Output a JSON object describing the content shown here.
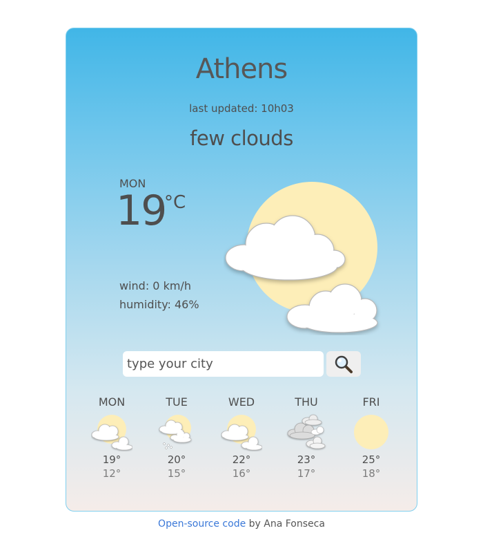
{
  "current": {
    "city": "Athens",
    "last_updated": "last updated: 10h03",
    "description": "few clouds",
    "day": "MON",
    "temperature": "19",
    "unit": "°C",
    "wind": "wind: 0 km/h",
    "humidity": "humidity: 46%",
    "icon": "sun-with-clouds-icon"
  },
  "search": {
    "placeholder": "type your city",
    "value": "",
    "button_icon": "magnifying-glass-icon"
  },
  "forecast": [
    {
      "day": "MON",
      "max": "19°",
      "min": "12°",
      "icon": "few-clouds-icon"
    },
    {
      "day": "TUE",
      "max": "20°",
      "min": "15°",
      "icon": "rain-clouds-icon"
    },
    {
      "day": "WED",
      "max": "22°",
      "min": "16°",
      "icon": "few-clouds-icon"
    },
    {
      "day": "THU",
      "max": "23°",
      "min": "17°",
      "icon": "overcast-clouds-icon"
    },
    {
      "day": "FRI",
      "max": "25°",
      "min": "18°",
      "icon": "sun-icon"
    }
  ],
  "footer": {
    "link_text": "Open-source code",
    "suffix": " by Ana Fonseca"
  },
  "colors": {
    "sun": "#fdeeb8",
    "cloud": "#ffffff",
    "link": "#3a78d8",
    "card_top": "#41b6e7",
    "card_bottom": "#f5ece9"
  }
}
